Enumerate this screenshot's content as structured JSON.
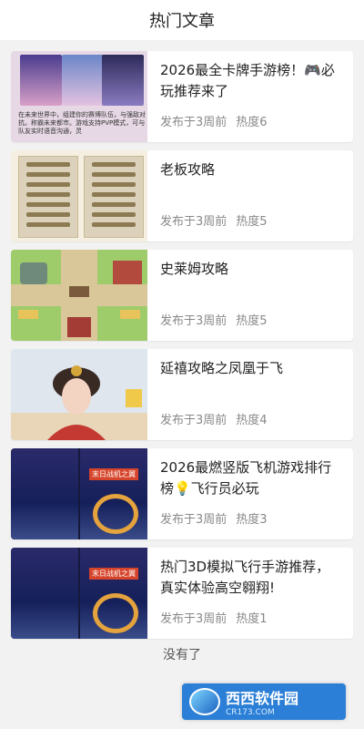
{
  "header": {
    "title": "热门文章"
  },
  "articles": [
    {
      "title": "2026最全卡牌手游榜！🎮必玩推荐来了",
      "published": "发布于3周前",
      "heat": "热度6",
      "thumb_caption": "在未来世界中，组建你的赛博队伍，与强敌对抗。称霸未来都市。游戏支持PVP模式，可与队友实时语音沟通，灵"
    },
    {
      "title": "老板攻略",
      "published": "发布于3周前",
      "heat": "热度5"
    },
    {
      "title": "史莱姆攻略",
      "published": "发布于3周前",
      "heat": "热度5"
    },
    {
      "title": "延禧攻略之凤凰于飞",
      "published": "发布于3周前",
      "heat": "热度4"
    },
    {
      "title": "2026最燃竖版飞机游戏排行榜💡飞行员必玩",
      "published": "发布于3周前",
      "heat": "热度3",
      "thumb_banner": "末日战机之翼"
    },
    {
      "title": "热门3D模拟飞行手游推荐，真实体验高空翱翔!",
      "published": "发布于3周前",
      "heat": "热度1",
      "thumb_banner": "末日战机之翼"
    }
  ],
  "footer": {
    "end_text": "没有了"
  },
  "watermark": {
    "brand": "西西软件园",
    "site": "CR173.COM"
  }
}
